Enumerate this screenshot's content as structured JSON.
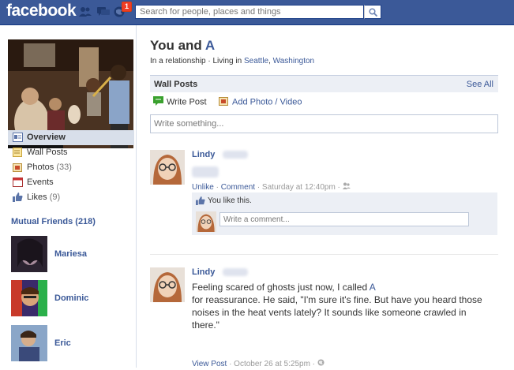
{
  "topbar": {
    "logo": "facebook",
    "search_placeholder": "Search for people, places and things",
    "notification_count": "1",
    "icons": [
      "friend-requests-icon",
      "messages-icon",
      "notifications-icon",
      "search-icon"
    ]
  },
  "sidebar": {
    "items": [
      {
        "label": "Overview",
        "count": "",
        "icon": "overview-icon"
      },
      {
        "label": "Wall Posts",
        "count": "",
        "icon": "wall-posts-icon"
      },
      {
        "label": "Photos",
        "count": "(33)",
        "icon": "photos-icon"
      },
      {
        "label": "Events",
        "count": "",
        "icon": "events-icon",
        "icon_text": "31"
      },
      {
        "label": "Likes",
        "count": "(9)",
        "icon": "likes-icon"
      }
    ],
    "mutual_friends_title": "Mutual Friends (218)",
    "friends": [
      {
        "name": "Mariesa"
      },
      {
        "name": "Dominic"
      },
      {
        "name": "Eric"
      }
    ]
  },
  "main": {
    "title_prefix": "You and ",
    "title_name": "A",
    "subtitle_prefix": "In a relationship · Living in ",
    "subtitle_city": "Seattle",
    "subtitle_sep": ", ",
    "subtitle_state": "Washington",
    "wall_title": "Wall Posts",
    "see_all": "See All",
    "write_post": "Write Post",
    "add_photo": "Add Photo / Video",
    "composer_placeholder": "Write something...",
    "stories": [
      {
        "author": "Lindy",
        "unlike": "Unlike",
        "comment": "Comment",
        "time": " · Saturday at 12:40pm · ",
        "likes_text": "You like this.",
        "comment_placeholder": "Write a comment..."
      },
      {
        "author": "Lindy",
        "text_line1_prefix": "Feeling scared of ghosts just now, I called ",
        "text_line1_name": "A",
        "text_rest": "for reassurance. He said, \"I'm sure it's fine. But have you heard those noises in the heat vents lately? It sounds like someone crawled in there.\"",
        "view_post": "View Post",
        "time": " · October 26 at 5:25pm · "
      }
    ]
  },
  "colors": {
    "brand": "#3b5998",
    "nav_active": "#d8dfea",
    "badge": "#f03d25"
  }
}
